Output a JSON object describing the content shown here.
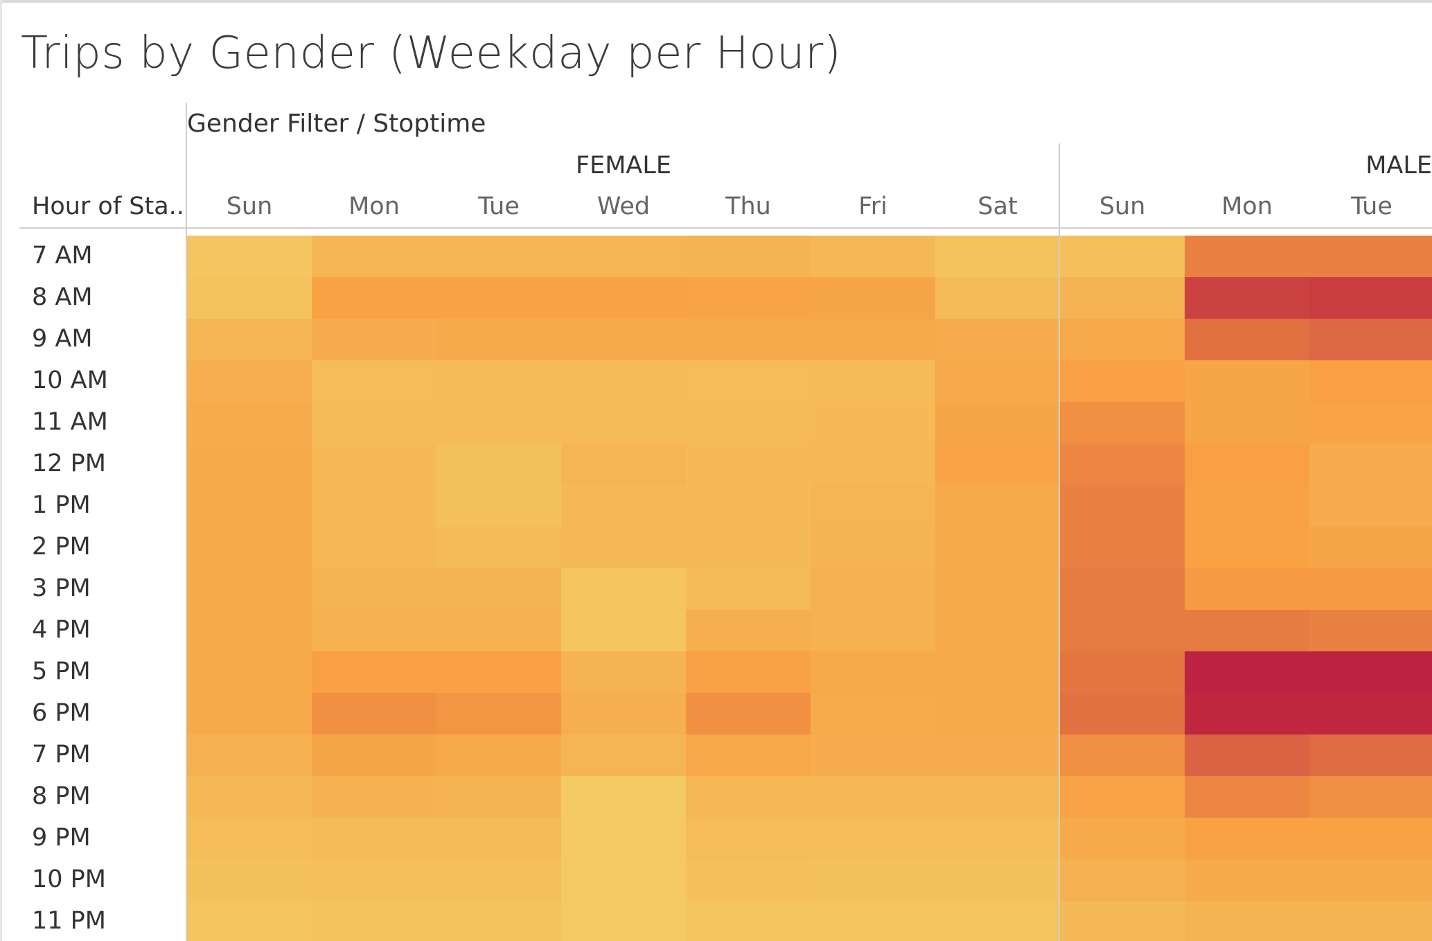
{
  "chart_data": {
    "type": "heatmap",
    "title": "Trips by Gender (Weekday per Hour)",
    "column_header": "Gender Filter / Stoptime",
    "row_header": "Hour of Sta..",
    "groups": [
      {
        "name": "FEMALE",
        "days": [
          "Sun",
          "Mon",
          "Tue",
          "Wed",
          "Thu",
          "Fri",
          "Sat"
        ]
      },
      {
        "name": "MALE",
        "days": [
          "Sun",
          "Mon",
          "Tue"
        ]
      }
    ],
    "hours": [
      "7 AM",
      "8 AM",
      "9 AM",
      "10 AM",
      "11 AM",
      "12 PM",
      "1 PM",
      "2 PM",
      "3 PM",
      "4 PM",
      "5 PM",
      "6 PM",
      "7 PM",
      "8 PM",
      "9 PM",
      "10 PM",
      "11 PM"
    ],
    "color_scale": {
      "low": "#f3d068",
      "mid": "#f8a043",
      "high": "#bb1e40"
    },
    "values": [
      [
        0.1,
        0.28,
        0.28,
        0.28,
        0.3,
        0.26,
        0.14,
        0.18,
        0.62,
        0.62
      ],
      [
        0.14,
        0.48,
        0.48,
        0.48,
        0.46,
        0.44,
        0.22,
        0.3,
        0.86,
        0.88
      ],
      [
        0.28,
        0.36,
        0.4,
        0.4,
        0.4,
        0.4,
        0.36,
        0.42,
        0.68,
        0.72
      ],
      [
        0.34,
        0.2,
        0.22,
        0.22,
        0.2,
        0.22,
        0.42,
        0.5,
        0.44,
        0.5
      ],
      [
        0.38,
        0.22,
        0.22,
        0.22,
        0.22,
        0.24,
        0.44,
        0.56,
        0.44,
        0.46
      ],
      [
        0.4,
        0.24,
        0.16,
        0.28,
        0.24,
        0.26,
        0.46,
        0.6,
        0.5,
        0.36
      ],
      [
        0.4,
        0.24,
        0.16,
        0.26,
        0.24,
        0.28,
        0.4,
        0.62,
        0.48,
        0.36
      ],
      [
        0.4,
        0.26,
        0.22,
        0.24,
        0.24,
        0.3,
        0.4,
        0.62,
        0.48,
        0.44
      ],
      [
        0.4,
        0.3,
        0.3,
        0.12,
        0.22,
        0.32,
        0.4,
        0.64,
        0.52,
        0.52
      ],
      [
        0.4,
        0.32,
        0.32,
        0.12,
        0.34,
        0.32,
        0.4,
        0.64,
        0.64,
        0.62
      ],
      [
        0.4,
        0.5,
        0.5,
        0.3,
        0.48,
        0.4,
        0.4,
        0.66,
        0.98,
        0.98
      ],
      [
        0.4,
        0.56,
        0.54,
        0.34,
        0.56,
        0.38,
        0.4,
        0.68,
        0.96,
        0.96
      ],
      [
        0.32,
        0.44,
        0.4,
        0.28,
        0.42,
        0.36,
        0.36,
        0.56,
        0.74,
        0.7
      ],
      [
        0.24,
        0.32,
        0.3,
        0.06,
        0.26,
        0.26,
        0.26,
        0.46,
        0.6,
        0.56
      ],
      [
        0.2,
        0.22,
        0.22,
        0.08,
        0.2,
        0.2,
        0.2,
        0.4,
        0.48,
        0.48
      ],
      [
        0.16,
        0.18,
        0.18,
        0.08,
        0.18,
        0.16,
        0.16,
        0.32,
        0.4,
        0.4
      ],
      [
        0.12,
        0.14,
        0.14,
        0.08,
        0.12,
        0.12,
        0.12,
        0.24,
        0.3,
        0.3
      ]
    ]
  }
}
